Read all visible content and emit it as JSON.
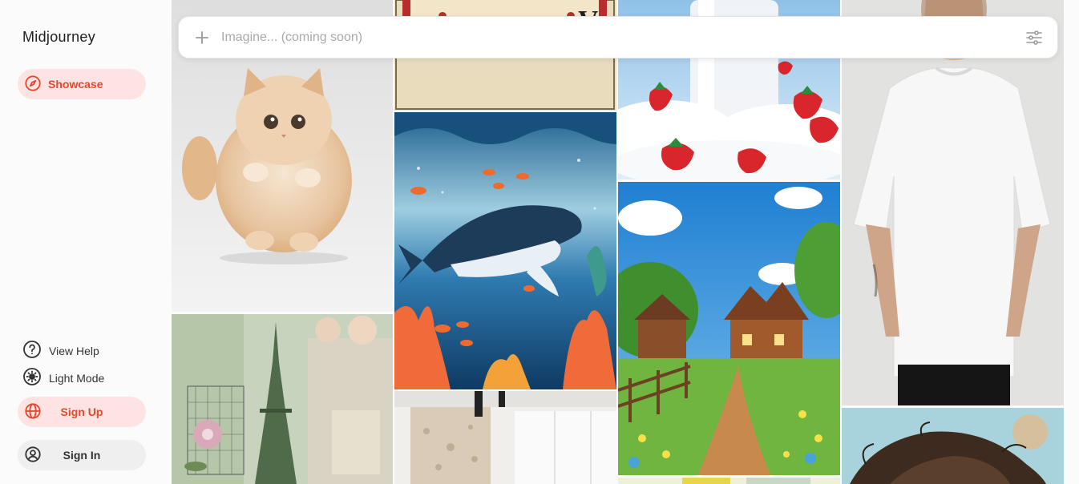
{
  "app": {
    "title": "Midjourney"
  },
  "nav": {
    "showcase_label": "Showcase",
    "view_help_label": "View Help",
    "light_mode_label": "Light Mode",
    "sign_up_label": "Sign Up",
    "sign_in_label": "Sign In"
  },
  "prompt": {
    "placeholder": "Imagine... (coming soon)",
    "value": ""
  },
  "icons": {
    "showcase": "compass-icon",
    "help": "question-circle-icon",
    "light_mode": "sun-icon",
    "sign_up": "globe-icon",
    "sign_in": "user-circle-icon",
    "add": "plus-icon",
    "filter": "sliders-icon"
  },
  "colors": {
    "accent": "#e5472f",
    "accent_bg": "#fde4e2",
    "neutral_pill": "#efefef",
    "background": "#fbfbfb"
  },
  "gallery": {
    "images": [
      "fluffy-cat-image",
      "playing-card-image",
      "whale-underwater-illustration",
      "interior-room-image",
      "strawberries-milk-image",
      "village-landscape-illustration",
      "scrapbook-eiffel-tower-image",
      "white-tshirt-model-image",
      "curly-hair-portrait-image"
    ]
  }
}
